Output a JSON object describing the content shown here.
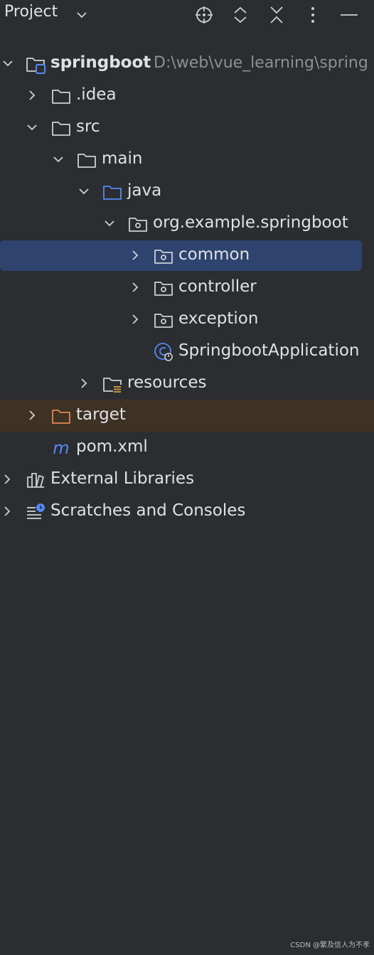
{
  "header": {
    "title": "Project",
    "tools": [
      "locate-icon",
      "expand-all-icon",
      "collapse-all-icon",
      "more-options-icon",
      "hide-icon"
    ]
  },
  "tree": {
    "root": {
      "label": "springboot",
      "path": "D:\\web\\vue_learning\\spring"
    },
    "idea": {
      "label": ".idea"
    },
    "src": {
      "label": "src"
    },
    "main": {
      "label": "main"
    },
    "java": {
      "label": "java"
    },
    "package": {
      "label": "org.example.springboot"
    },
    "common": {
      "label": "common"
    },
    "controller": {
      "label": "controller"
    },
    "exception": {
      "label": "exception"
    },
    "app": {
      "label": "SpringbootApplication"
    },
    "resources": {
      "label": "resources"
    },
    "target": {
      "label": "target"
    },
    "pom": {
      "label": "pom.xml"
    },
    "external": {
      "label": "External Libraries"
    },
    "scratches": {
      "label": "Scratches and Consoles"
    }
  },
  "colors": {
    "background": "#2b2d30",
    "selection": "#2e436e",
    "excluded_row": "#3d3223",
    "source_folder": "#548af7",
    "excluded_folder": "#e08855",
    "icon_gray": "#ced0d6"
  },
  "watermark": "CSDN @繁及信人为不孝"
}
